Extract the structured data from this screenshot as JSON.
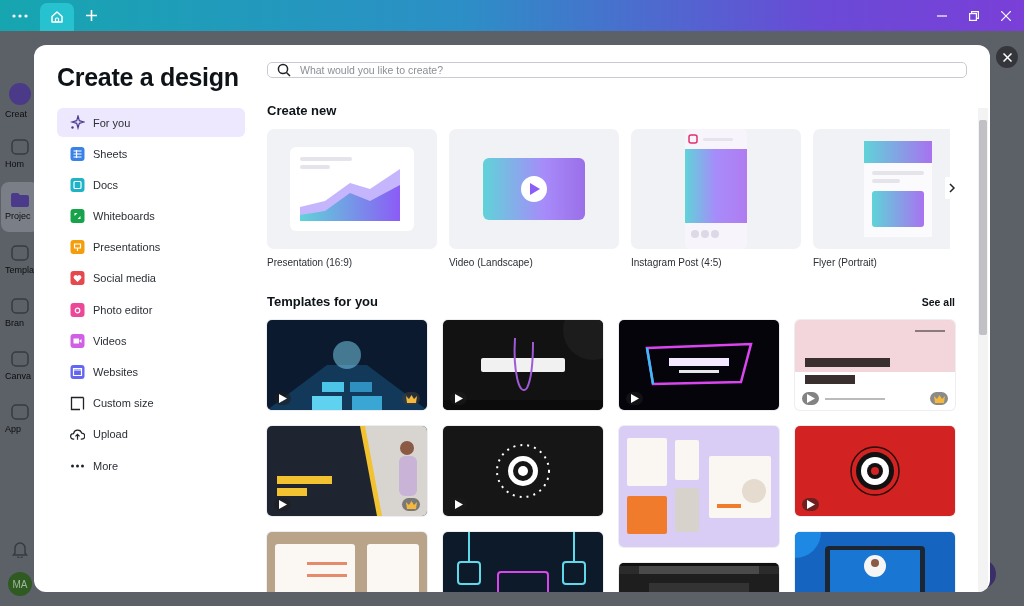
{
  "tab_bar": {
    "tabs": [
      {
        "selected": true
      }
    ]
  },
  "app_rail": {
    "items": [
      {
        "label": "Creat",
        "selected": false
      },
      {
        "label": "Hom",
        "selected": false
      },
      {
        "label": "Projec",
        "selected": true
      },
      {
        "label": "Templa",
        "selected": false
      },
      {
        "label": "Bran",
        "selected": false
      },
      {
        "label": "Canva",
        "selected": false
      },
      {
        "label": "App",
        "selected": false
      }
    ],
    "avatar": "MA"
  },
  "dialog": {
    "title": "Create a design",
    "nav": [
      {
        "label": "For you",
        "selected": true
      },
      {
        "label": "Sheets",
        "selected": false,
        "color": "#3b82e6"
      },
      {
        "label": "Docs",
        "selected": false,
        "color": "#1fb3c8"
      },
      {
        "label": "Whiteboards",
        "selected": false,
        "color": "#16a34a"
      },
      {
        "label": "Presentations",
        "selected": false,
        "color": "#f59e0b"
      },
      {
        "label": "Social media",
        "selected": false,
        "color": "#e5484d"
      },
      {
        "label": "Photo editor",
        "selected": false,
        "color": "#ec4899"
      },
      {
        "label": "Videos",
        "selected": false,
        "color": "#d15fe6"
      },
      {
        "label": "Websites",
        "selected": false,
        "color": "#6366f1"
      },
      {
        "label": "Custom size",
        "selected": false
      },
      {
        "label": "Upload",
        "selected": false
      },
      {
        "label": "More",
        "selected": false
      }
    ],
    "search": {
      "placeholder": "What would you like to create?"
    },
    "create_new": {
      "heading": "Create new",
      "cards": [
        {
          "label": "Presentation (16:9)"
        },
        {
          "label": "Video (Landscape)"
        },
        {
          "label": "Instagram Post (4:5)"
        },
        {
          "label": "Flyer (Portrait)"
        }
      ]
    },
    "templates": {
      "heading": "Templates for you",
      "see_all": "See all",
      "columns": [
        [
          {
            "kind": "video",
            "premium": true
          },
          {
            "kind": "video",
            "premium": true
          },
          {
            "kind": "design"
          }
        ],
        [
          {
            "kind": "video",
            "premium": false
          },
          {
            "kind": "video",
            "premium": false
          },
          {
            "kind": "design"
          }
        ],
        [
          {
            "kind": "video",
            "premium": false
          },
          {
            "kind": "collage",
            "premium": false
          },
          {
            "kind": "design"
          }
        ],
        [
          {
            "kind": "video",
            "premium": true
          },
          {
            "kind": "video",
            "premium": false
          },
          {
            "kind": "design"
          }
        ]
      ]
    }
  }
}
